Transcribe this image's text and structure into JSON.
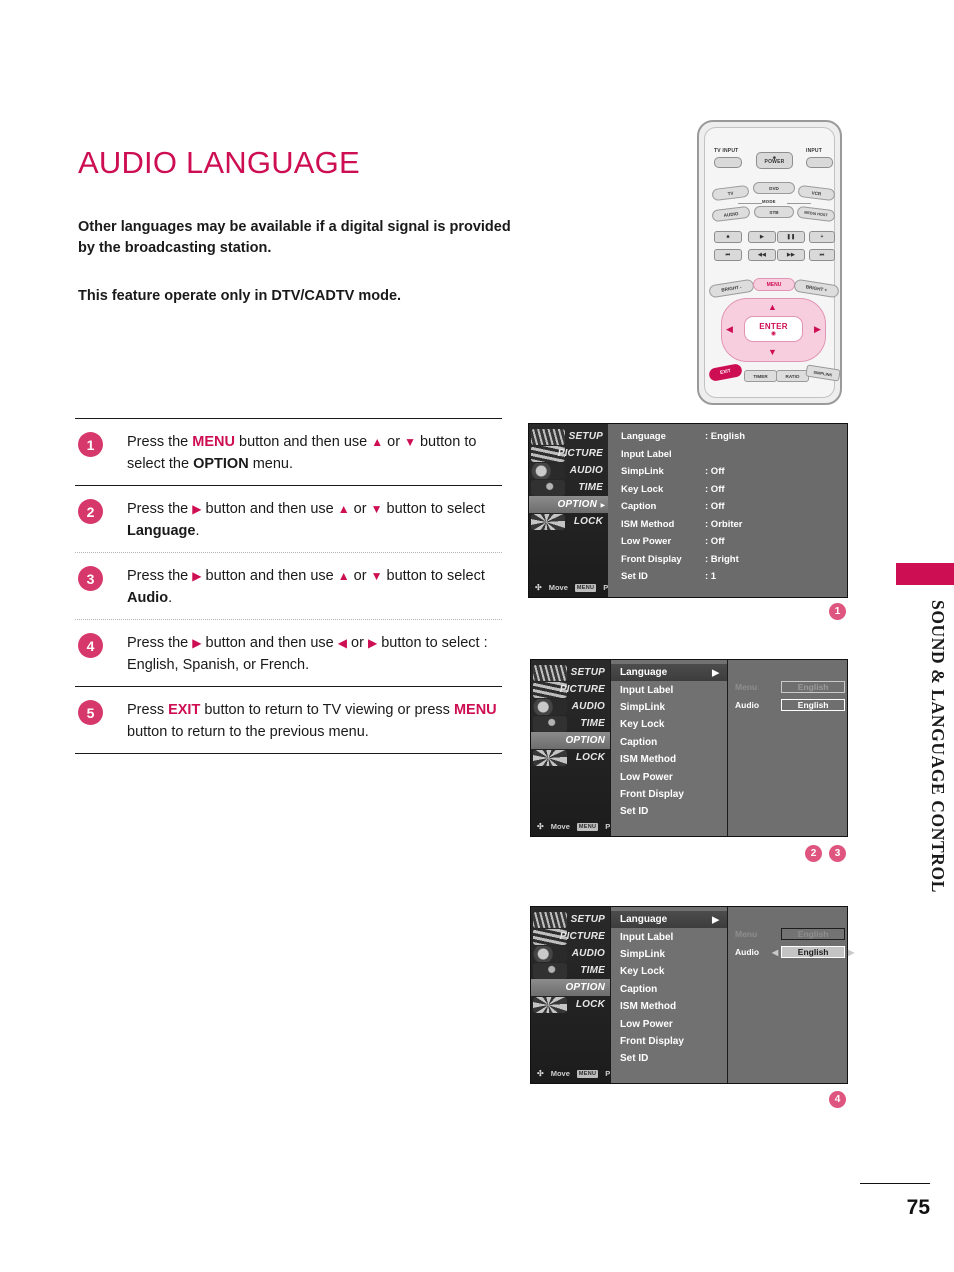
{
  "page": {
    "title": "AUDIO LANGUAGE",
    "intro_1": "Other languages may be available if a digital signal is provided by the broadcasting station.",
    "intro_2": "This feature operate only in DTV/CADTV mode.",
    "chapter_tab": "SOUND & LANGUAGE CONTROL",
    "page_number": "75",
    "accent_color": "#CE0E52",
    "badge_color": "#D7386B"
  },
  "steps": [
    {
      "number": "1",
      "parts": [
        {
          "t": "Press the ",
          "s": "plain"
        },
        {
          "t": "MENU",
          "s": "kw"
        },
        {
          "t": " button and then use ",
          "s": "plain"
        },
        {
          "t": "▲",
          "s": "arrow"
        },
        {
          "t": " or ",
          "s": "plain"
        },
        {
          "t": "▼",
          "s": "arrow"
        },
        {
          "t": " button to select the ",
          "s": "plain"
        },
        {
          "t": "OPTION",
          "s": "bold"
        },
        {
          "t": " menu.",
          "s": "plain"
        }
      ]
    },
    {
      "number": "2",
      "parts": [
        {
          "t": "Press the ",
          "s": "plain"
        },
        {
          "t": "▶",
          "s": "arrow"
        },
        {
          "t": " button and then use ",
          "s": "plain"
        },
        {
          "t": "▲",
          "s": "arrow"
        },
        {
          "t": " or ",
          "s": "plain"
        },
        {
          "t": "▼",
          "s": "arrow"
        },
        {
          "t": " button to select ",
          "s": "plain"
        },
        {
          "t": "Language",
          "s": "bold"
        },
        {
          "t": ".",
          "s": "plain"
        }
      ]
    },
    {
      "number": "3",
      "parts": [
        {
          "t": "Press the ",
          "s": "plain"
        },
        {
          "t": "▶",
          "s": "arrow"
        },
        {
          "t": " button and then use ",
          "s": "plain"
        },
        {
          "t": "▲",
          "s": "arrow"
        },
        {
          "t": " or ",
          "s": "plain"
        },
        {
          "t": "▼",
          "s": "arrow"
        },
        {
          "t": " button to select ",
          "s": "plain"
        },
        {
          "t": "Audio",
          "s": "bold"
        },
        {
          "t": ".",
          "s": "plain"
        }
      ]
    },
    {
      "number": "4",
      "parts": [
        {
          "t": "Press the ",
          "s": "plain"
        },
        {
          "t": "▶",
          "s": "arrow"
        },
        {
          "t": " button and then use  ",
          "s": "plain"
        },
        {
          "t": "◀",
          "s": "arrow"
        },
        {
          "t": " or ",
          "s": "plain"
        },
        {
          "t": "▶",
          "s": "arrow"
        },
        {
          "t": " button to select : English, Spanish, or French.",
          "s": "plain"
        }
      ]
    },
    {
      "number": "5",
      "parts": [
        {
          "t": "Press ",
          "s": "plain"
        },
        {
          "t": "EXIT",
          "s": "kw"
        },
        {
          "t": " button to return to TV viewing or press ",
          "s": "plain"
        },
        {
          "t": "MENU",
          "s": "kw"
        },
        {
          "t": " button to return to the previous menu.",
          "s": "plain"
        }
      ]
    }
  ],
  "osd": {
    "side_items": [
      "SETUP",
      "PICTURE",
      "AUDIO",
      "TIME",
      "OPTION",
      "LOCK"
    ],
    "footer": {
      "move": "Move",
      "prev_chip": "MENU",
      "prev": "Prev"
    },
    "menu_rows_with_values": [
      {
        "label": "Language",
        "value": ": English"
      },
      {
        "label": "Input Label",
        "value": ""
      },
      {
        "label": "SimpLink",
        "value": ": Off"
      },
      {
        "label": "Key Lock",
        "value": ": Off"
      },
      {
        "label": "Caption",
        "value": ": Off"
      },
      {
        "label": "ISM Method",
        "value": ": Orbiter"
      },
      {
        "label": "Low Power",
        "value": ": Off"
      },
      {
        "label": "Front Display",
        "value": ": Bright"
      },
      {
        "label": "Set ID",
        "value": ": 1"
      }
    ],
    "menu_rows_plain": [
      "Language",
      "Input Label",
      "SimpLink",
      "Key Lock",
      "Caption",
      "ISM Method",
      "Low Power",
      "Front Display",
      "Set ID"
    ],
    "detail": {
      "menu_label": "Menu",
      "menu_value": "English",
      "audio_label": "Audio",
      "audio_value": "English"
    }
  },
  "callouts": {
    "osd1": "1",
    "osd2_a": "2",
    "osd2_b": "3",
    "osd3": "4"
  },
  "remote": {
    "tv_input": "TV INPUT",
    "power": "POWER",
    "input": "INPUT",
    "tv": "TV",
    "dvd": "DVD",
    "vcr": "VCR",
    "mode": "MODE",
    "audio": "AUDIO",
    "stb": "STB",
    "media_host": "MEDIA HOST",
    "bright_minus": "BRIGHT -",
    "menu": "MENU",
    "bright_plus": "BRIGHT +",
    "enter": "ENTER",
    "exit": "EXIT",
    "timer": "TIMER",
    "ratio": "RATIO",
    "simplink": "SIMPLINK"
  }
}
